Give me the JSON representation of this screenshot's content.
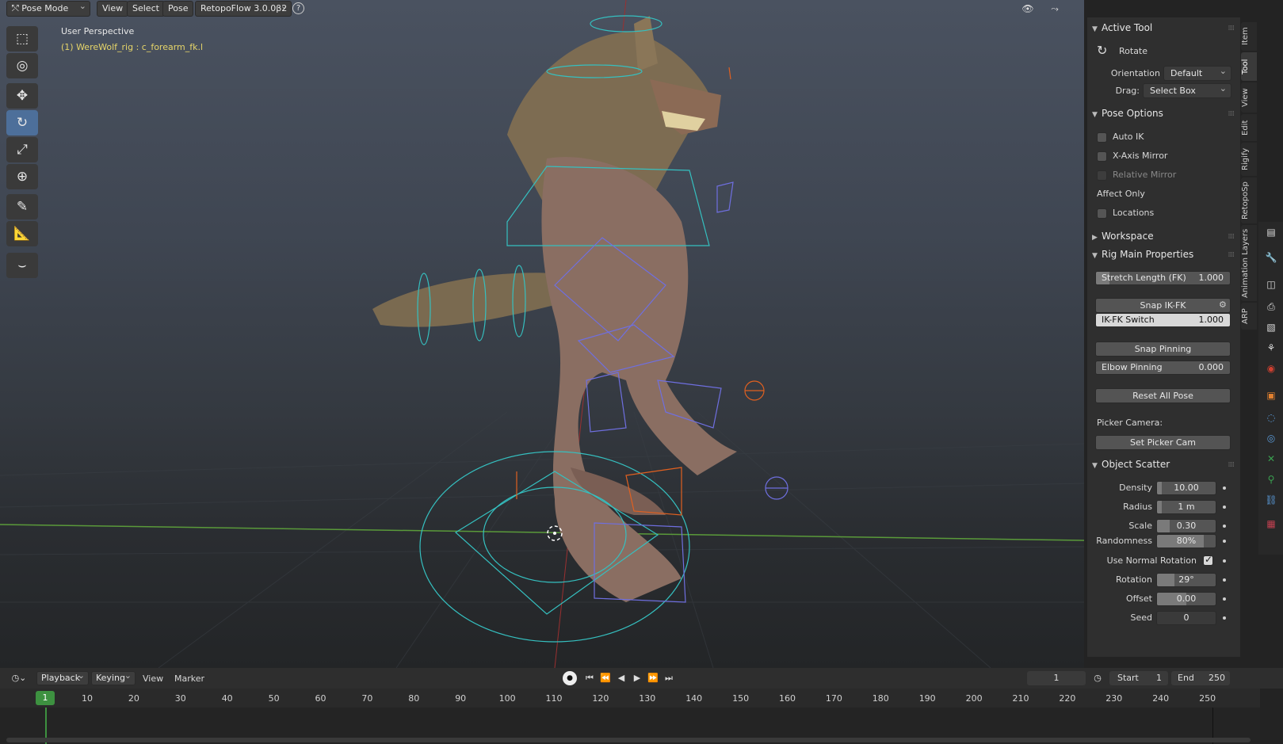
{
  "header": {
    "mode": "Pose Mode",
    "menus": [
      "View",
      "Select",
      "Pose"
    ],
    "addon": "RetopoFlow 3.0.0β2",
    "help_icon": "?"
  },
  "viewport": {
    "perspective": "User Perspective",
    "object": "(1) WereWolf_rig : c_forearm_fk.l"
  },
  "tools": [
    {
      "name": "select-box-tool",
      "glyph": "⬚"
    },
    {
      "name": "cursor-tool",
      "glyph": "◎"
    },
    {
      "name": "move-tool",
      "glyph": "✥"
    },
    {
      "name": "rotate-tool",
      "glyph": "↻"
    },
    {
      "name": "scale-tool",
      "glyph": "⤢"
    },
    {
      "name": "transform-tool",
      "glyph": "⊕"
    },
    {
      "name": "annotate-tool",
      "glyph": "✎"
    },
    {
      "name": "measure-tool",
      "glyph": "📐"
    },
    {
      "name": "bone-roll-tool",
      "glyph": "⌣"
    }
  ],
  "npanel": {
    "active_tool": {
      "title": "Active Tool",
      "tool": "Rotate",
      "orientation_label": "Orientation",
      "orientation_value": "Default",
      "drag_label": "Drag:",
      "drag_value": "Select Box"
    },
    "pose_options": {
      "title": "Pose Options",
      "auto_ik": "Auto IK",
      "x_axis_mirror": "X-Axis Mirror",
      "relative_mirror": "Relative Mirror",
      "affect_only": "Affect Only",
      "locations": "Locations"
    },
    "workspace": {
      "title": "Workspace"
    },
    "rig_main": {
      "title": "Rig Main Properties",
      "stretch_label": "Stretch Length (FK)",
      "stretch_value": "1.000",
      "stretch_fill": 0.1,
      "snap_ikfk": "Snap IK-FK",
      "ikfk_label": "IK-FK Switch",
      "ikfk_value": "1.000",
      "ikfk_fill": 1.0,
      "snap_pinning": "Snap Pinning",
      "elbow_label": "Elbow Pinning",
      "elbow_value": "0.000",
      "reset_all_pose": "Reset All Pose",
      "picker_camera": "Picker Camera:",
      "set_picker_cam": "Set Picker Cam"
    },
    "object_scatter": {
      "title": "Object Scatter",
      "rows": [
        {
          "label": "Density",
          "value": "10.00",
          "fill": 0.08,
          "type": "field"
        },
        {
          "label": "Radius",
          "value": "1 m",
          "fill": 0.08,
          "type": "field"
        },
        {
          "label": "Scale",
          "value": "0.30",
          "fill": 0.22,
          "type": "field"
        },
        {
          "label": "Randomness",
          "value": "80%",
          "fill": 0.8,
          "type": "field"
        },
        {
          "label": "Use Normal Rotation",
          "checked": true,
          "type": "check"
        },
        {
          "label": "Rotation",
          "value": "29°",
          "fill": 0.3,
          "type": "field"
        },
        {
          "label": "Offset",
          "value": "0.00",
          "fill": 0.5,
          "type": "field"
        },
        {
          "label": "Seed",
          "value": "0",
          "fill": 0,
          "type": "field"
        }
      ]
    }
  },
  "vtabs": [
    {
      "label": "Item",
      "active": false
    },
    {
      "label": "Tool",
      "active": true
    },
    {
      "label": "View",
      "active": false
    },
    {
      "label": "Edit",
      "active": false
    },
    {
      "label": "Rigify",
      "active": false
    },
    {
      "label": "RetopoSp",
      "active": false
    },
    {
      "label": "Animation Layers",
      "active": false
    },
    {
      "label": "ARP",
      "active": false
    }
  ],
  "timeline": {
    "menus": [
      "Playback",
      "Keying",
      "View",
      "Marker"
    ],
    "current_frame": "1",
    "start_label": "Start",
    "start_value": "1",
    "end_label": "End",
    "end_value": "250",
    "ticks": [
      "10",
      "20",
      "30",
      "40",
      "50",
      "60",
      "70",
      "80",
      "90",
      "100",
      "110",
      "120",
      "130",
      "140",
      "150",
      "160",
      "170",
      "180",
      "190",
      "200",
      "210",
      "220",
      "230",
      "240",
      "250"
    ],
    "frame_marker": "1"
  },
  "colors": {
    "accent": "#4d6f9a",
    "frame_marker": "#3d9140",
    "object_text": "#e6d56a",
    "rig_cyan": "#35c0c0",
    "rig_blue": "#6f6fe0",
    "rig_orange": "#e06020"
  }
}
